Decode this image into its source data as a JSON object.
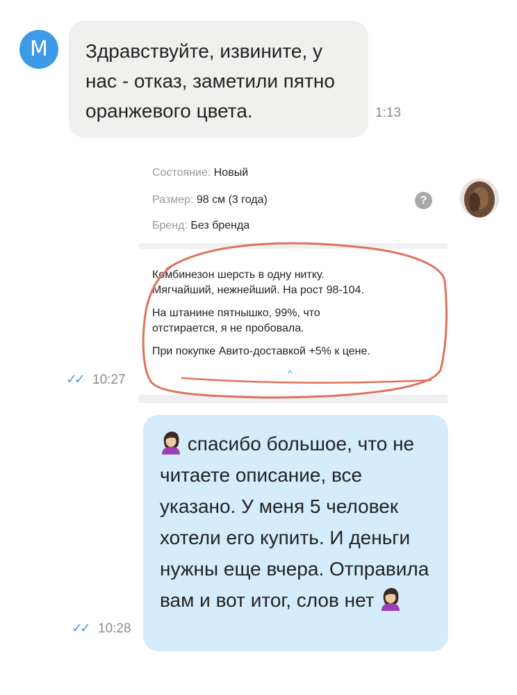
{
  "incoming": {
    "avatar_letter": "M",
    "text": "Здравствуйте, извините, у нас - отказ, заметили пятно оранжевого цвета.",
    "time": "1:13"
  },
  "listing": {
    "attrs": [
      {
        "key": "Состояние:",
        "value": "Новый"
      },
      {
        "key": "Размер:",
        "value": "98 см (3 года)"
      },
      {
        "key": "Бренд:",
        "value": "Без бренда"
      }
    ],
    "help_icon_glyph": "?",
    "description": [
      "Комбинезон шерсть в одну нитку.",
      "Мягчайший, нежнейший. На рост 98-104.",
      "На штанине пятнышко, 99%, что",
      "отстирается, я не пробовала.",
      "При покупке Авито-доставкой +5% к цене."
    ],
    "collapse_glyph": "^",
    "time": "10:27",
    "ticks": "✓✓"
  },
  "outgoing": {
    "text_main": "спасибо большое, что не читаете описание, все указано. У меня 5 человек хотели его купить. И деньги нужны еще вчера. Отправила вам и вот итог, слов нет",
    "time": "10:28",
    "ticks": "✓✓"
  },
  "colors": {
    "accent": "#3d9ae8",
    "incoming_bubble": "#f0f0ee",
    "outgoing_bubble": "#d5ecfc",
    "scribble": "#e0715a"
  }
}
